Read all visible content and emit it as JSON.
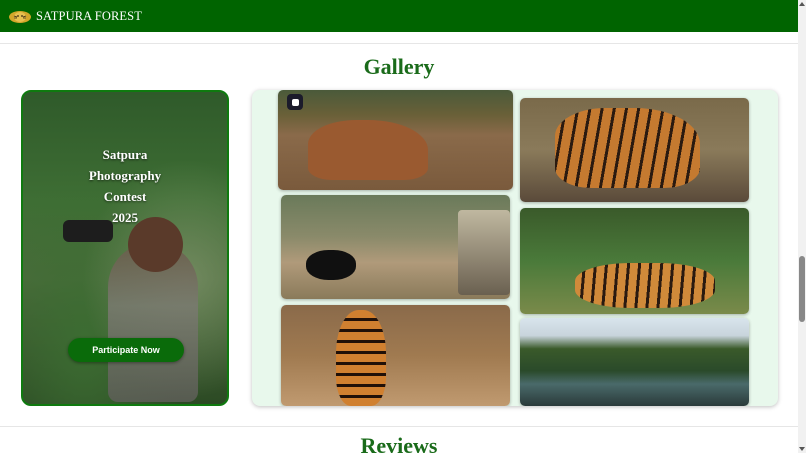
{
  "navbar": {
    "brand": "SATPURA FOREST",
    "logo_icon": "tiger-emblem-icon",
    "bg_color": "#006400"
  },
  "gallery": {
    "title": "Gallery",
    "contest": {
      "lines": [
        "Satpura",
        "Photography",
        "Contest",
        "2025"
      ],
      "button_label": "Participate Now"
    },
    "photos": [
      {
        "name": "deer"
      },
      {
        "name": "tiger-walking"
      },
      {
        "name": "sloth-bear-and-safari-jeep"
      },
      {
        "name": "tigers-resting"
      },
      {
        "name": "tiger-portrait"
      },
      {
        "name": "river-landscape"
      }
    ]
  },
  "reviews": {
    "title": "Reviews"
  },
  "colors": {
    "accent": "#0a6b0a",
    "title_green": "#1a6b1a",
    "grid_bg": "#e8f8ec"
  }
}
